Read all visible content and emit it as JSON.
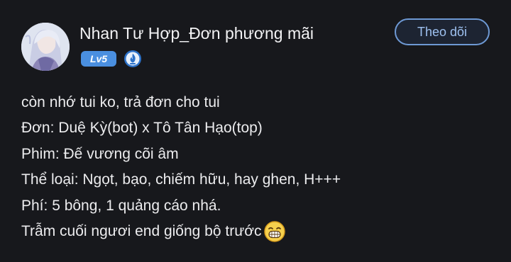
{
  "post": {
    "author": {
      "name": "Nhan Tư Hợp_Đơn phương mãi",
      "level": "Lv5",
      "avatar_icon": "avatar-image",
      "medal_icon": "fire-medal-icon"
    },
    "follow_label": "Theo dõi",
    "lines": [
      "còn nhớ tui ko, trả đơn cho tui",
      "Đơn: Duệ Kỳ(bot) x Tô Tân Hạo(top)",
      "Phim: Đế vương cõi âm",
      "Thể loại: Ngọt, bạo, chiếm hữu, hay ghen, H+++",
      "Phí: 5 bông, 1 quảng cáo nhá.",
      "Trẫm cuối ngươi end giống bộ trước"
    ],
    "trailing_emoji": "grinning-face-emoji"
  },
  "colors": {
    "background": "#17181c",
    "accent": "#6e99d4",
    "level_badge": "#4a8fe0",
    "text": "#ececee"
  }
}
